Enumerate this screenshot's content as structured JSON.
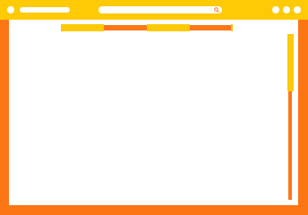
{
  "window": {
    "title": "",
    "colors": {
      "frame": "#fd7616",
      "titlebar": "#fdca05",
      "page": "#ffffff"
    }
  },
  "titlebar": {
    "left_dot_icon": "circle-icon",
    "tab_title_placeholder": "",
    "window_controls": [
      "dot-icon",
      "dot-icon",
      "dot-icon"
    ]
  },
  "address_bar": {
    "value": "",
    "placeholder": "",
    "icon": "search-icon"
  },
  "tabs": [
    {
      "label": "",
      "state": "active"
    },
    {
      "label": "",
      "state": "inactive"
    },
    {
      "label": "",
      "state": "active"
    },
    {
      "label": "",
      "state": "inactive"
    }
  ],
  "scrollbar": {
    "position_fraction": 0.0,
    "visible_fraction": 0.34
  }
}
